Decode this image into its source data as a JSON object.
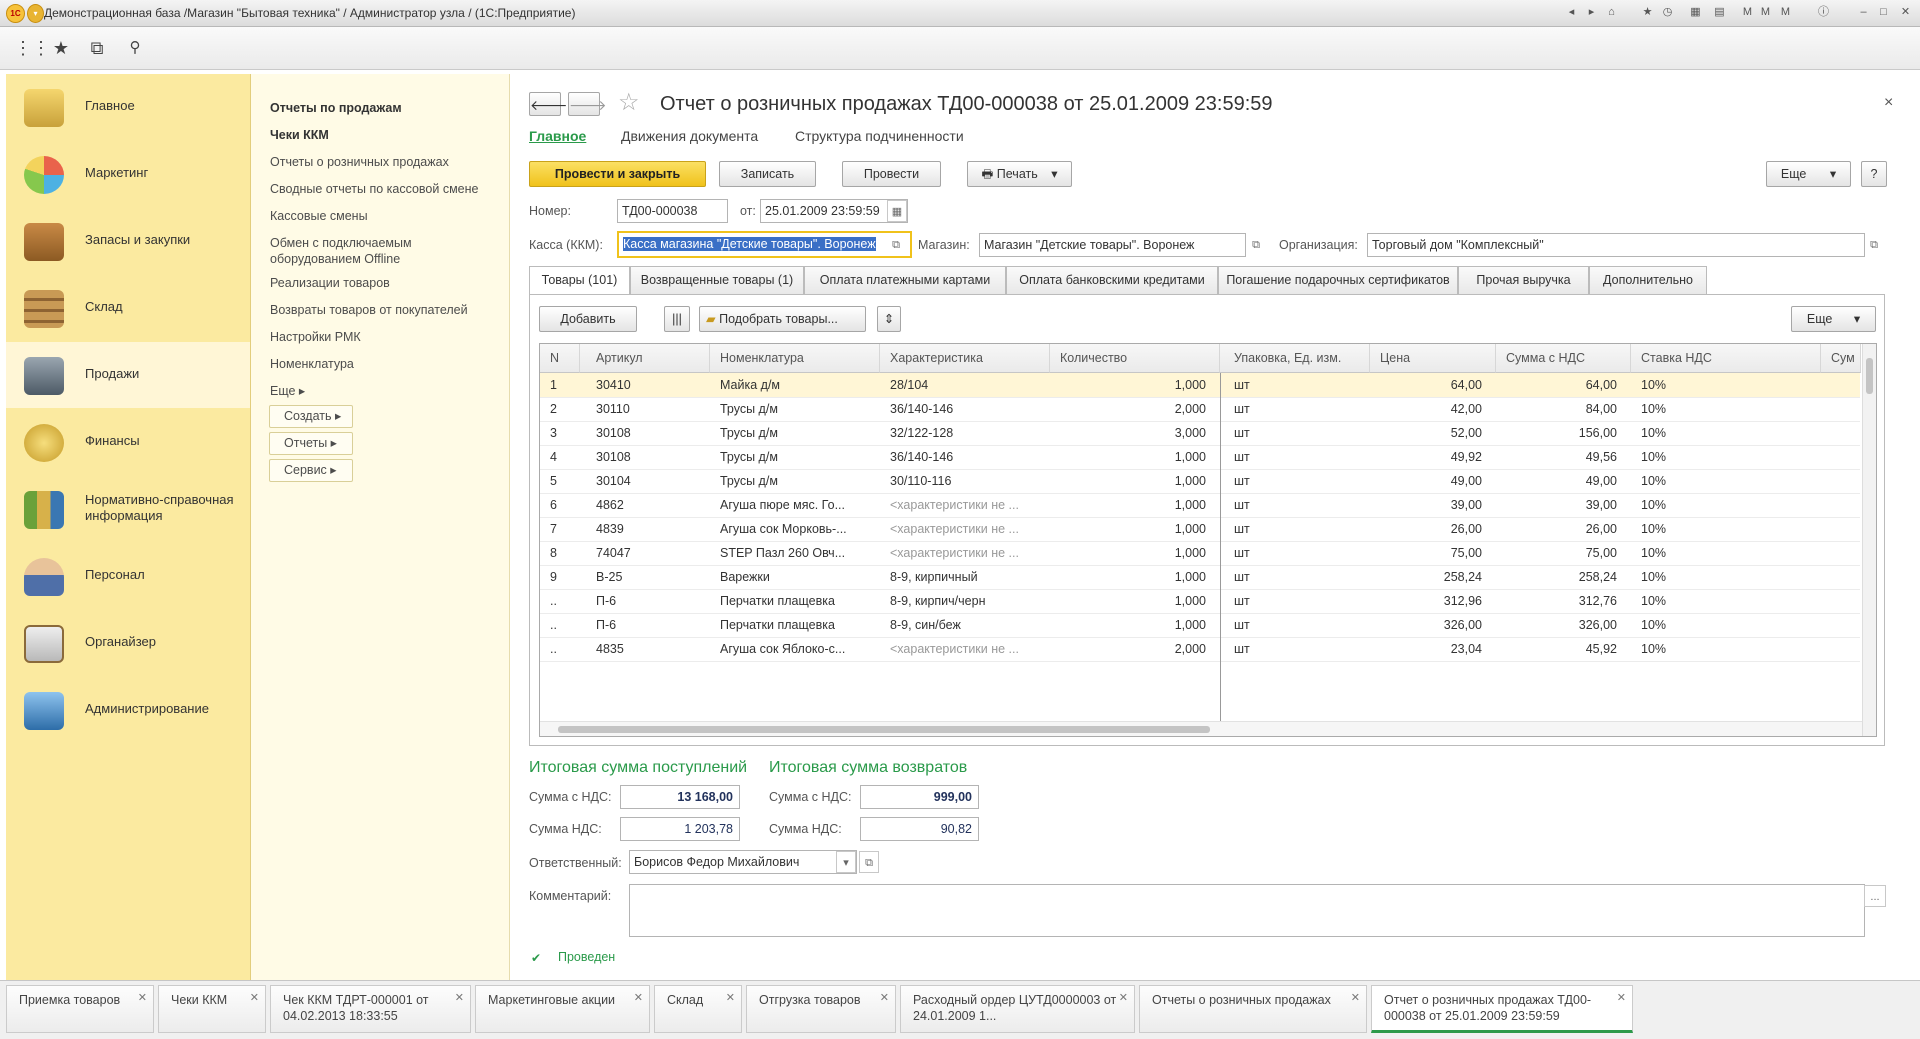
{
  "window": {
    "title": "Демонстрационная база /Магазин \"Бытовая техника\" / Администратор узла / (1С:Предприятие)",
    "logo": "1C"
  },
  "sections": [
    {
      "label": "Главное",
      "icon": "desk-lamp-icon",
      "active": false
    },
    {
      "label": "Маркетинг",
      "icon": "pie-chart-icon",
      "active": false
    },
    {
      "label": "Запасы и закупки",
      "icon": "boxes-icon",
      "active": false
    },
    {
      "label": "Склад",
      "icon": "warehouse-shelf-icon",
      "active": false
    },
    {
      "label": "Продажи",
      "icon": "cash-register-icon",
      "active": true
    },
    {
      "label": "Финансы",
      "icon": "coins-icon",
      "active": false
    },
    {
      "label": "Нормативно-справочная информация",
      "icon": "binders-icon",
      "active": false
    },
    {
      "label": "Персонал",
      "icon": "person-icon",
      "active": false
    },
    {
      "label": "Органайзер",
      "icon": "clipboard-icon",
      "active": false
    },
    {
      "label": "Администрирование",
      "icon": "computer-icon",
      "active": false
    }
  ],
  "nav": {
    "items": [
      "Отчеты по продажам",
      "Чеки ККМ",
      "Отчеты о розничных продажах",
      "Сводные отчеты по кассовой смене",
      "Кассовые смены",
      "Обмен с подключаемым оборудованием Offline",
      "Реализации товаров",
      "Возвраты товаров от покупателей",
      "Настройки РМК",
      "Номенклатура",
      "Еще ▸"
    ],
    "buttons": [
      "Создать ▸",
      "Отчеты ▸",
      "Сервис ▸"
    ]
  },
  "doc": {
    "title": "Отчет о розничных продажах ТД00-000038 от 25.01.2009 23:59:59",
    "subtabs": [
      "Главное",
      "Движения документа",
      "Структура подчиненности"
    ],
    "buttons": {
      "post_close": "Провести и закрыть",
      "save": "Записать",
      "post": "Провести",
      "print": "Печать",
      "more": "Еще",
      "help": "?"
    },
    "number_label": "Номер:",
    "number": "ТД00-000038",
    "date_label": "от:",
    "date": "25.01.2009 23:59:59",
    "kassa_label": "Касса (ККМ):",
    "kassa": "Касса магазина \"Детские товары\". Воронеж",
    "shop_label": "Магазин:",
    "shop": "Магазин \"Детские товары\". Воронеж",
    "org_label": "Организация:",
    "org": "Торговый дом \"Комплексный\"",
    "tabs": [
      "Товары (101)",
      "Возвращенные товары (1)",
      "Оплата платежными картами",
      "Оплата банковскими кредитами",
      "Погашение подарочных сертификатов",
      "Прочая выручка",
      "Дополнительно"
    ],
    "table_buttons": {
      "add": "Добавить",
      "pick": "Подобрать товары...",
      "more": "Еще"
    },
    "columns": [
      "N",
      "Артикул",
      "Номенклатура",
      "Характеристика",
      "Количество",
      "Упаковка, Ед. изм.",
      "Цена",
      "Сумма с НДС",
      "Ставка НДС",
      "Сум"
    ],
    "rows": [
      [
        "1",
        "30410",
        "Майка д/м",
        "28/104",
        "1,000",
        "шт",
        "64,00",
        "64,00",
        "10%"
      ],
      [
        "2",
        "30110",
        "Трусы д/м",
        "36/140-146",
        "2,000",
        "шт",
        "42,00",
        "84,00",
        "10%"
      ],
      [
        "3",
        "30108",
        "Трусы д/м",
        "32/122-128",
        "3,000",
        "шт",
        "52,00",
        "156,00",
        "10%"
      ],
      [
        "4",
        "30108",
        "Трусы д/м",
        "36/140-146",
        "1,000",
        "шт",
        "49,92",
        "49,56",
        "10%"
      ],
      [
        "5",
        "30104",
        "Трусы д/м",
        "30/110-116",
        "1,000",
        "шт",
        "49,00",
        "49,00",
        "10%"
      ],
      [
        "6",
        "4862",
        "Агуша пюре мяс. Го...",
        "<характеристики не ...",
        "1,000",
        "шт",
        "39,00",
        "39,00",
        "10%"
      ],
      [
        "7",
        "4839",
        "Агуша сок Морковь-...",
        "<характеристики не ...",
        "1,000",
        "шт",
        "26,00",
        "26,00",
        "10%"
      ],
      [
        "8",
        "74047",
        "STEP Пазл 260 Овч...",
        "<характеристики не ...",
        "1,000",
        "шт",
        "75,00",
        "75,00",
        "10%"
      ],
      [
        "9",
        "В-25",
        "Варежки",
        "8-9, кирпичный",
        "1,000",
        "шт",
        "258,24",
        "258,24",
        "10%"
      ],
      [
        "..",
        "П-6",
        "Перчатки плащевка",
        "8-9, кирпич/черн",
        "1,000",
        "шт",
        "312,96",
        "312,76",
        "10%"
      ],
      [
        "..",
        "П-6",
        "Перчатки плащевка",
        "8-9, син/беж",
        "1,000",
        "шт",
        "326,00",
        "326,00",
        "10%"
      ],
      [
        "..",
        "4835",
        "Агуша сок Яблоко-с...",
        "<характеристики не ...",
        "2,000",
        "шт",
        "23,04",
        "45,92",
        "10%"
      ]
    ],
    "totals": {
      "income_title": "Итоговая сумма поступлений",
      "return_title": "Итоговая сумма возвратов",
      "sum_vat_label": "Сумма с НДС:",
      "vat_label": "Сумма НДС:",
      "income_sum": "13 168,00",
      "income_vat": "1 203,78",
      "return_sum": "999,00",
      "return_vat": "90,82"
    },
    "responsible_label": "Ответственный:",
    "responsible": "Борисов Федор Михайлович",
    "comment_label": "Комментарий:",
    "comment": "",
    "status": "Проведен"
  },
  "bottom_tabs": [
    {
      "label": "Приемка товаров",
      "active": false
    },
    {
      "label": "Чеки ККМ",
      "active": false
    },
    {
      "label": "Чек ККМ ТДРТ-000001 от 04.02.2013 18:33:55",
      "active": false
    },
    {
      "label": "Маркетинговые акции",
      "active": false
    },
    {
      "label": "Склад",
      "active": false
    },
    {
      "label": "Отгрузка товаров",
      "active": false
    },
    {
      "label": "Расходный ордер ЦУТД0000003 от 24.01.2009 1...",
      "active": false
    },
    {
      "label": "Отчеты о розничных продажах",
      "active": false
    },
    {
      "label": "Отчет о розничных продажах ТД00-000038 от 25.01.2009 23:59:59",
      "active": true
    }
  ],
  "colors": {
    "accent_yellow": "#f0c21b",
    "section_bg": "#fbeaa0",
    "nav_bg": "#fffbe6",
    "selected_row": "#fff6d6",
    "green": "#2a9a4a"
  }
}
